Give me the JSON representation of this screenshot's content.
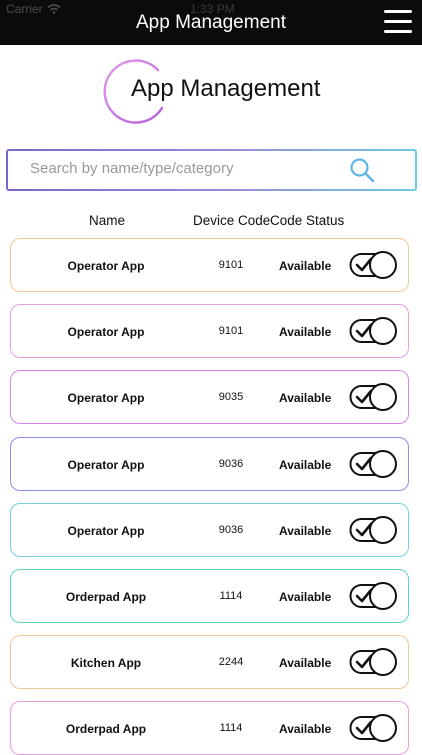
{
  "status_bar": {
    "carrier": "Carrier",
    "time": "1:33 PM"
  },
  "header": {
    "title": "App Management",
    "menu_icon": "hamburger-menu-icon"
  },
  "logo": {
    "text": "App Management"
  },
  "search": {
    "placeholder": "Search by name/type/category",
    "value": "",
    "icon": "search-icon"
  },
  "columns": {
    "name": "Name",
    "device_code": "Device Code",
    "code_status": "Code Status"
  },
  "rows": [
    {
      "name": "Operator App",
      "code": "9101",
      "status": "Available",
      "border": "#f0c796"
    },
    {
      "name": "Operator App",
      "code": "9101",
      "status": "Available",
      "border": "#e59ee0"
    },
    {
      "name": "Operator App",
      "code": "9035",
      "status": "Available",
      "border": "#d685e6"
    },
    {
      "name": "Operator App",
      "code": "9036",
      "status": "Available",
      "border": "#8b8ee6"
    },
    {
      "name": "Operator App",
      "code": "9036",
      "status": "Available",
      "border": "#74d2e0"
    },
    {
      "name": "Orderpad App",
      "code": "1114",
      "status": "Available",
      "border": "#5fd7c3"
    },
    {
      "name": "Kitchen App",
      "code": "2244",
      "status": "Available",
      "border": "#f0c796"
    },
    {
      "name": "Orderpad App",
      "code": "1114",
      "status": "Available",
      "border": "#e59ee0"
    }
  ],
  "colors": {
    "navbar": "#0b0b0b",
    "accent_purple": "#c86be0",
    "accent_blue": "#6ecbe0"
  }
}
